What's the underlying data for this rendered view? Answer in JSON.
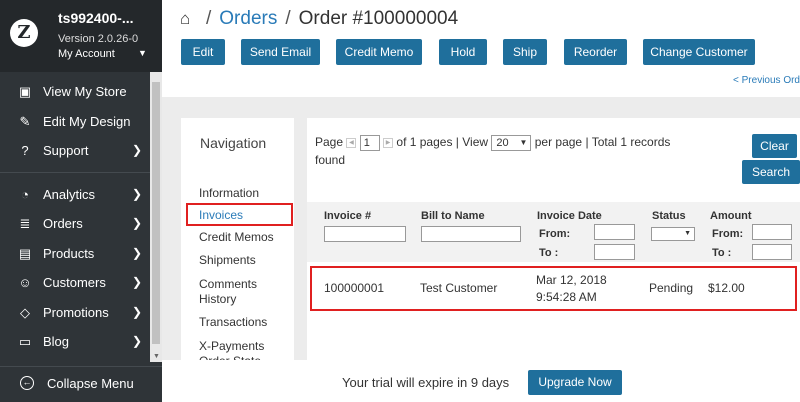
{
  "sidebar": {
    "logo_glyph": "Z",
    "store_name": "ts992400-...",
    "version": "Version 2.0.26-0",
    "account_label": "My Account",
    "items": [
      {
        "label": "View My Store",
        "icon": "monitor-icon",
        "glyph": "▣"
      },
      {
        "label": "Edit My Design",
        "icon": "pencil-icon",
        "glyph": "✎"
      },
      {
        "label": "Support",
        "icon": "question-icon",
        "glyph": "?"
      },
      {
        "label": "Analytics",
        "icon": "analytics-icon",
        "glyph": "◔"
      },
      {
        "label": "Orders",
        "icon": "database-icon",
        "glyph": "≣"
      },
      {
        "label": "Products",
        "icon": "box-icon",
        "glyph": "▤"
      },
      {
        "label": "Customers",
        "icon": "user-icon",
        "glyph": "☺"
      },
      {
        "label": "Promotions",
        "icon": "tag-icon",
        "glyph": "◇"
      },
      {
        "label": "Blog",
        "icon": "book-icon",
        "glyph": "▭"
      }
    ],
    "collapse_label": "Collapse Menu"
  },
  "breadcrumb": {
    "orders": "Orders",
    "current": "Order #100000004"
  },
  "toolbar": {
    "edit": "Edit",
    "send_email": "Send Email",
    "credit_memo": "Credit Memo",
    "hold": "Hold",
    "ship": "Ship",
    "reorder": "Reorder",
    "change_customer": "Change Customer"
  },
  "previous_order": "< Previous Ord",
  "navigation": {
    "title": "Navigation",
    "items": [
      "Information",
      "Invoices",
      "Credit Memos",
      "Shipments",
      "Comments History",
      "Transactions",
      "X-Payments Order State"
    ],
    "selected": "Invoices"
  },
  "grid": {
    "pager": {
      "page_label": "Page",
      "page_value": "1",
      "of_pages": "of 1 pages",
      "view_label": "View",
      "per_page_value": "20",
      "per_page_label": "per page",
      "total": "Total 1 records",
      "found": "found"
    },
    "clear_label": "Clear",
    "search_label": "Search",
    "columns": [
      "Invoice #",
      "Bill to Name",
      "Invoice Date",
      "Status",
      "Amount"
    ],
    "filter_from": "From:",
    "filter_to": "To :",
    "rows": [
      {
        "invoice": "100000001",
        "bill_to": "Test Customer",
        "date": "Mar 12, 2018",
        "time": "9:54:28 AM",
        "status": "Pending",
        "amount": "$12.00"
      }
    ]
  },
  "trial": {
    "message": "Your trial will expire in 9 days",
    "upgrade_label": "Upgrade Now"
  },
  "colors": {
    "sidebar_bg": "#2f3438",
    "primary_button": "#1f6f9c",
    "link": "#2a7bb8",
    "highlight_border": "#e02020"
  }
}
